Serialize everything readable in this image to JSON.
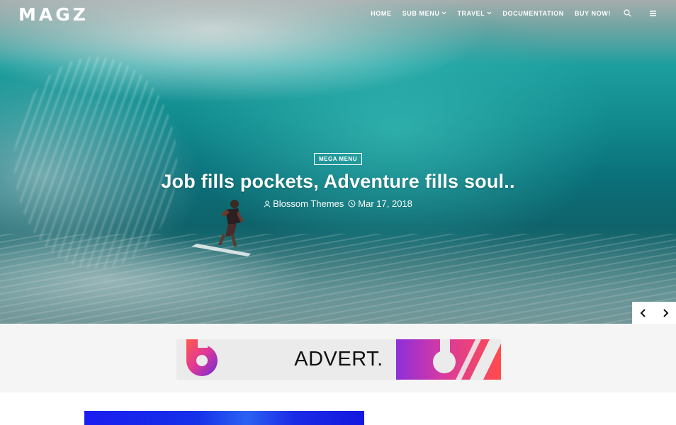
{
  "header": {
    "logo": "MAGZ",
    "nav": [
      {
        "label": "HOME",
        "has_dropdown": false
      },
      {
        "label": "SUB MENU",
        "has_dropdown": true
      },
      {
        "label": "TRAVEL",
        "has_dropdown": true
      },
      {
        "label": "DOCUMENTATION",
        "has_dropdown": false
      },
      {
        "label": "BUY NOW!",
        "has_dropdown": false
      }
    ],
    "icons": [
      "search-icon",
      "hamburger-menu-icon"
    ]
  },
  "hero": {
    "category": "MEGA MENU",
    "title": "Job fills pockets, Adventure fills soul..",
    "author": "Blossom Themes",
    "date": "Mar 17, 2018",
    "arrows": [
      "chevron-left-icon",
      "chevron-right-icon"
    ]
  },
  "ad": {
    "text": "ADVERT."
  },
  "colors": {
    "text_light": "#ffffff",
    "ad_background": "#ebebeb",
    "section_background": "#f5f5f5"
  }
}
